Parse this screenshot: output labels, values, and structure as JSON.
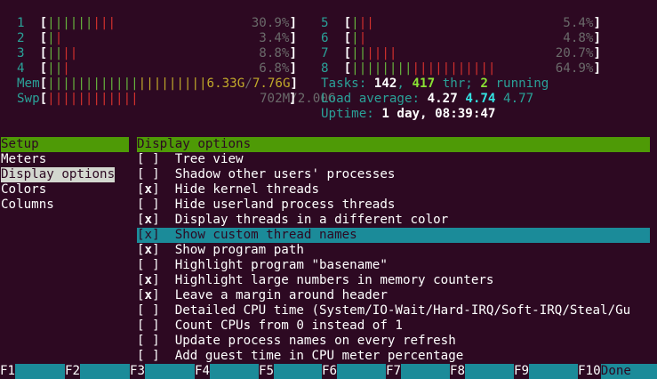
{
  "meters": {
    "cpus_left": [
      {
        "num": "1",
        "bar_red": "|||",
        "bar_green": "||||||",
        "pct": "30.9%"
      },
      {
        "num": "2",
        "bar_red": "|",
        "bar_green": "|",
        "pct": "3.4%"
      },
      {
        "num": "3",
        "bar_red": "||",
        "bar_green": "||",
        "pct": "8.8%"
      },
      {
        "num": "4",
        "bar_red": "|",
        "bar_green": "||",
        "pct": "6.8%"
      }
    ],
    "cpus_right": [
      {
        "num": "5",
        "bar_red": "||",
        "bar_green": "|",
        "pct": "5.4%"
      },
      {
        "num": "6",
        "bar_red": "|",
        "bar_green": "|",
        "pct": "4.8%"
      },
      {
        "num": "7",
        "bar_red": "||||",
        "bar_green": "||",
        "pct": "20.7%"
      },
      {
        "num": "8",
        "bar_red": "|||||||||||",
        "bar_green": "||||||||",
        "pct": "64.9%"
      }
    ],
    "mem": {
      "label": "Mem",
      "bar_green": "||||||||||||",
      "bar_yel": "|||||||||",
      "used": "6.33G",
      "sep": "/",
      "total": "7.76G"
    },
    "swp": {
      "label": "Swp",
      "bar_red": "||||||||||||",
      "used": "702M",
      "total": "2.00G"
    },
    "tasks": {
      "label": "Tasks:",
      "tasks": "142",
      "thr": "417",
      "thr_label": "thr;",
      "running": "2",
      "running_label": "running"
    },
    "load": {
      "label": "Load average:",
      "l1": "4.27",
      "l5": "4.74",
      "l15": "4.77"
    },
    "uptime": {
      "label": "Uptime:",
      "value": "1 day, 08:39:47"
    }
  },
  "setup": {
    "categories_header": "Setup",
    "categories": [
      "Meters",
      "Display options",
      "Colors",
      "Columns"
    ],
    "selected_category": "Display options",
    "options_header": "Display options",
    "options": [
      {
        "checked": false,
        "label": "Tree view"
      },
      {
        "checked": false,
        "label": "Shadow other users' processes"
      },
      {
        "checked": true,
        "label": "Hide kernel threads"
      },
      {
        "checked": false,
        "label": "Hide userland process threads"
      },
      {
        "checked": true,
        "label": "Display threads in a different color"
      },
      {
        "checked": true,
        "label": "Show custom thread names",
        "highlighted": true
      },
      {
        "checked": true,
        "label": "Show program path"
      },
      {
        "checked": false,
        "label": "Highlight program \"basename\""
      },
      {
        "checked": true,
        "label": "Highlight large numbers in memory counters"
      },
      {
        "checked": true,
        "label": "Leave a margin around header"
      },
      {
        "checked": false,
        "label": "Detailed CPU time (System/IO-Wait/Hard-IRQ/Soft-IRQ/Steal/Gu"
      },
      {
        "checked": false,
        "label": "Count CPUs from 0 instead of 1"
      },
      {
        "checked": false,
        "label": "Update process names on every refresh"
      },
      {
        "checked": false,
        "label": "Add guest time in CPU meter percentage"
      }
    ]
  },
  "function_bar": [
    {
      "key": "F1",
      "label": ""
    },
    {
      "key": "F2",
      "label": ""
    },
    {
      "key": "F3",
      "label": ""
    },
    {
      "key": "F4",
      "label": ""
    },
    {
      "key": "F5",
      "label": ""
    },
    {
      "key": "F6",
      "label": ""
    },
    {
      "key": "F7",
      "label": ""
    },
    {
      "key": "F8",
      "label": ""
    },
    {
      "key": "F9",
      "label": ""
    },
    {
      "key": "F10",
      "label": "Done"
    }
  ],
  "colors": {
    "background": "#2d0922",
    "header_green": "#4e9a06",
    "highlight_teal": "#1b8b99",
    "bar_red": "#d1302d",
    "bar_green": "#66b33d",
    "bar_yellow": "#c1a92a"
  }
}
